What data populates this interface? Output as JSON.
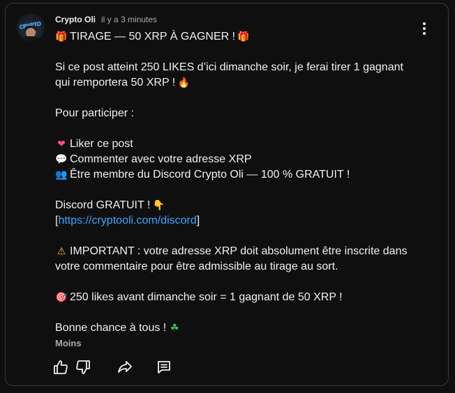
{
  "post": {
    "author": "Crypto Oli",
    "time": "il y a 3 minutes",
    "avatar_text": "CRYPTO OLI",
    "lines": {
      "l1": "TIRAGE — 50 XRP À GAGNER !",
      "l2": "Si ce post atteint 250 LIKES d’ici dimanche soir, je ferai tirer 1 gagnant",
      "l3": "qui remportera 50 XRP !",
      "l4": "Pour participer :",
      "l5": "Liker ce post",
      "l6": "Commenter avec votre adresse XRP",
      "l7": "Être membre du Discord Crypto Oli — 100 % GRATUIT !",
      "l8": "Discord GRATUIT !",
      "l9_open": "[",
      "l9_link": "https://cryptooli.com/discord",
      "l9_close": "]",
      "l10": "IMPORTANT : votre adresse XRP doit absolument être inscrite dans",
      "l11": "votre commentaire pour être admissible au tirage au sort.",
      "l12": "250 likes avant dimanche soir = 1 gagnant de 50 XRP !",
      "l13": "Bonne chance à tous !"
    },
    "emojis": {
      "gift": "🎁",
      "fire": "🔥",
      "heart": "❤",
      "bubble": "💬",
      "people": "👥",
      "point_down": "👇",
      "warning": "⚠",
      "target": "🎯",
      "clover": "☘"
    },
    "less_label": "Moins"
  },
  "actions": {
    "like_icon": "thumbs-up-icon",
    "dislike_icon": "thumbs-down-icon",
    "share_icon": "share-icon",
    "comment_icon": "comment-icon"
  },
  "colors": {
    "background": "#0f0f0f",
    "border": "#3a3a3a",
    "text": "#f1f1f1",
    "muted": "#aaaaaa",
    "link": "#3ea6ff"
  }
}
